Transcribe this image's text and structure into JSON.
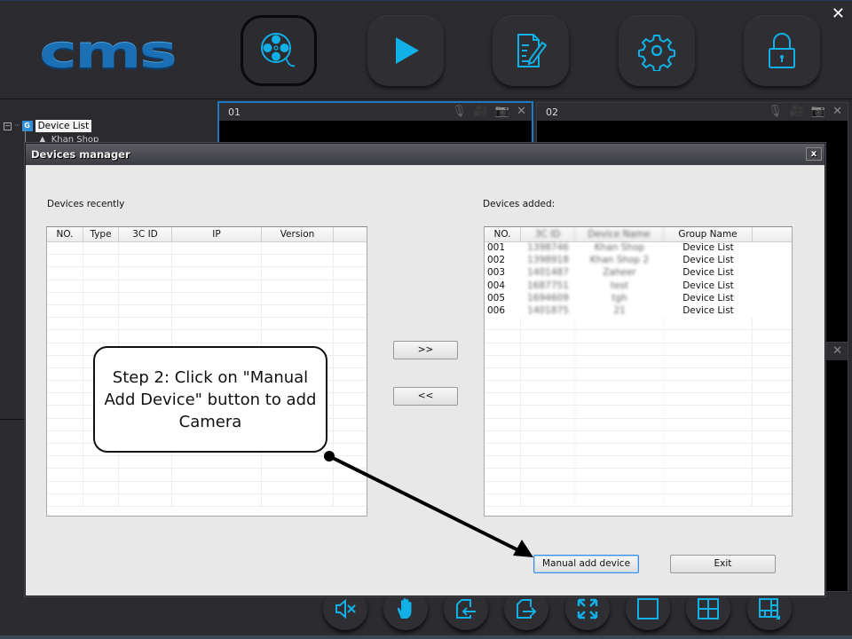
{
  "app": {
    "logo_text": "cms",
    "close_glyph": "✕",
    "accent_color": "#11b0e6",
    "nav_buttons": [
      {
        "name": "playback-reel",
        "icon": "film-reel-icon",
        "active": true
      },
      {
        "name": "live-play",
        "icon": "play-icon",
        "active": false
      },
      {
        "name": "log-editor",
        "icon": "document-edit-icon",
        "active": false
      },
      {
        "name": "settings",
        "icon": "gear-icon",
        "active": false
      },
      {
        "name": "lock",
        "icon": "lock-icon",
        "active": false
      }
    ]
  },
  "tree": {
    "toggle_glyph": "−",
    "group_icon_letter": "G",
    "root_label": "Device List",
    "child_label": "Khan Shop"
  },
  "panes": [
    {
      "id": "01",
      "selected": true
    },
    {
      "id": "02",
      "selected": false
    }
  ],
  "pane_tools": {
    "mic": "🎙",
    "record": "🎥",
    "snapshot": "📷",
    "close": "✕"
  },
  "dialog": {
    "title": "Devices manager",
    "close_glyph": "x",
    "recent_label": "Devices recently",
    "recent_columns": [
      "NO.",
      "Type",
      "3C ID",
      "IP",
      "Version",
      ""
    ],
    "recent_rows": [],
    "added_label": "Devices added:",
    "added_columns": [
      "NO.",
      "3C ID",
      "Device Name",
      "Group Name",
      ""
    ],
    "added_rows": [
      {
        "no": "001",
        "id": "1398746",
        "name": "Khan Shop",
        "group": "Device List"
      },
      {
        "no": "002",
        "id": "1398918",
        "name": "Khan Shop 2",
        "group": "Device List"
      },
      {
        "no": "003",
        "id": "1401487",
        "name": "Zaheer",
        "group": "Device List"
      },
      {
        "no": "004",
        "id": "1687751",
        "name": "test",
        "group": "Device List"
      },
      {
        "no": "005",
        "id": "1694609",
        "name": "tgh",
        "group": "Device List"
      },
      {
        "no": "006",
        "id": "1401875",
        "name": "21",
        "group": "Device List"
      }
    ],
    "move_right_label": ">>",
    "move_left_label": "<<",
    "manual_add_label": "Manual add device",
    "exit_label": "Exit"
  },
  "callout": {
    "text": "Step 2: Click on \"Manual Add Device\" button to add Camera"
  },
  "bottom_buttons": [
    {
      "name": "mute",
      "icon": "speaker-mute-icon"
    },
    {
      "name": "ptz-hand",
      "icon": "hand-icon"
    },
    {
      "name": "previous-page",
      "icon": "page-back-icon"
    },
    {
      "name": "next-page",
      "icon": "page-forward-icon"
    },
    {
      "name": "fullscreen",
      "icon": "fullscreen-icon"
    },
    {
      "name": "layout-1",
      "icon": "single-view-icon"
    },
    {
      "name": "layout-4",
      "icon": "quad-view-icon"
    },
    {
      "name": "layout-custom",
      "icon": "multi-view-icon"
    }
  ]
}
